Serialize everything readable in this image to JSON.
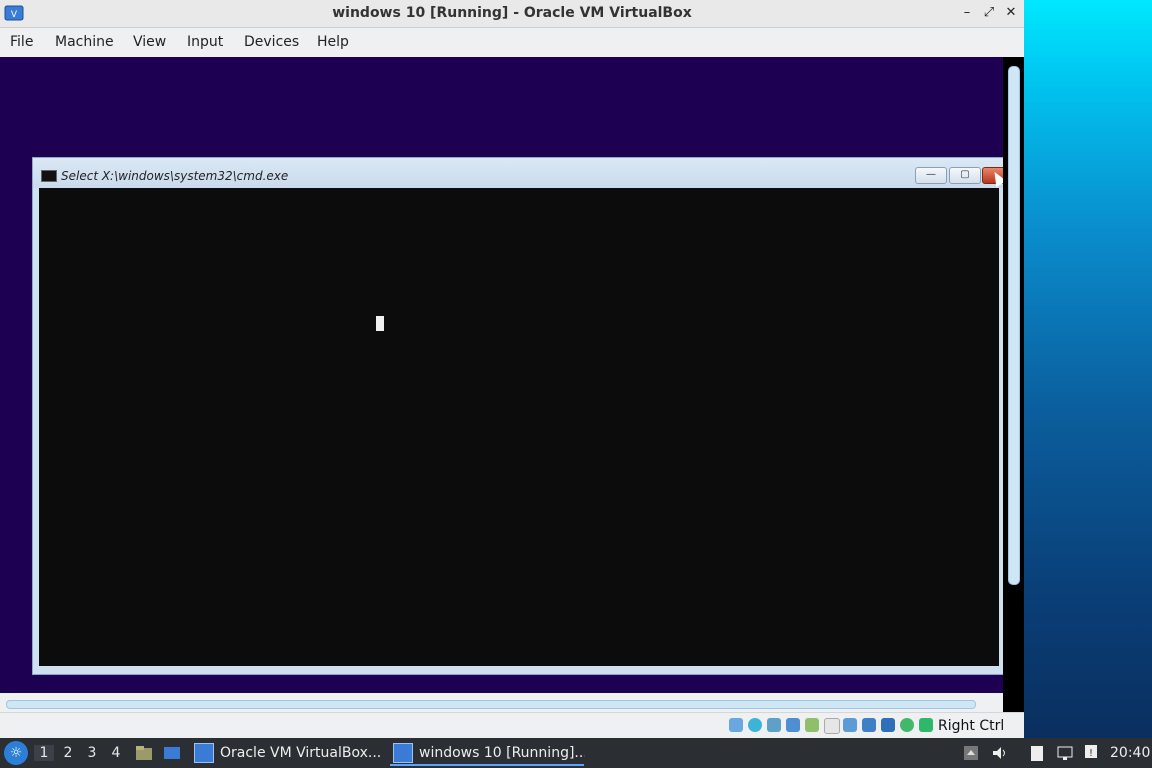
{
  "vbox": {
    "title": "windows 10 [Running] - Oracle VM VirtualBox",
    "window_controls": {
      "minimize": "–",
      "restore": "⤢",
      "close": "✕"
    },
    "menu": [
      "File",
      "Machine",
      "View",
      "Input",
      "Devices",
      "Help"
    ],
    "host_key": "Right Ctrl"
  },
  "guest": {
    "cmd_title": "Select X:\\windows\\system32\\cmd.exe",
    "cmd_controls": {
      "minimize": "—",
      "maximize": "▢"
    }
  },
  "statusbar_icons": [
    "hard-disk-icon",
    "optical-drive-icon",
    "audio-icon",
    "network-icon",
    "usb-icon",
    "shared-folders-icon",
    "display-icon",
    "recording-icon",
    "vm-state-icon",
    "cpu-icon",
    "mouse-integration-icon"
  ],
  "taskbar": {
    "desktops": [
      "1",
      "2",
      "3",
      "4"
    ],
    "active_desktop": "1",
    "tasks": [
      {
        "label": "Oracle VM VirtualBox...",
        "active": false
      },
      {
        "label": "windows 10 [Running]...",
        "active": true
      }
    ],
    "clock": "20:40"
  },
  "colors": {
    "vm_background": "#1e0053",
    "console_background": "#0c0c0c",
    "taskbar": "#2b2e33",
    "accent": "#5aa5ff"
  }
}
